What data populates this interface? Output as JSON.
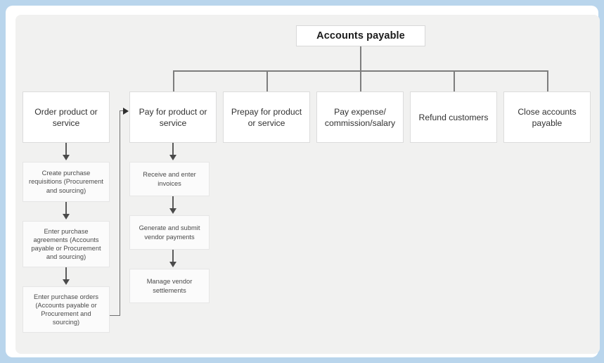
{
  "diagram": {
    "title": "Accounts payable",
    "root": {
      "label": "Accounts payable"
    },
    "level2": [
      {
        "label": "Order product or service"
      },
      {
        "label": "Pay for product or service"
      },
      {
        "label": "Prepay for product or service"
      },
      {
        "label": "Pay expense/ commission/salary"
      },
      {
        "label": "Refund customers"
      },
      {
        "label": "Close accounts payable"
      }
    ],
    "order_steps": [
      {
        "label": "Create purchase requisitions (Procurement and sourcing)"
      },
      {
        "label": "Enter purchase agreements (Accounts payable or Procurement and sourcing)"
      },
      {
        "label": "Enter purchase orders (Accounts payable or Procurement and sourcing)"
      }
    ],
    "pay_steps": [
      {
        "label": "Receive and enter invoices"
      },
      {
        "label": "Generate and submit vendor payments"
      },
      {
        "label": "Manage vendor settlements"
      }
    ],
    "colors": {
      "page_background": "#b9d5ec",
      "frame": "#ffffff",
      "canvas": "#f1f1f0",
      "node_fill": "#ffffff",
      "substep_fill": "#fbfbfb",
      "connector": "#7d7d7d",
      "arrow": "#4a4a4a",
      "title_text": "#1b1b1b"
    }
  }
}
